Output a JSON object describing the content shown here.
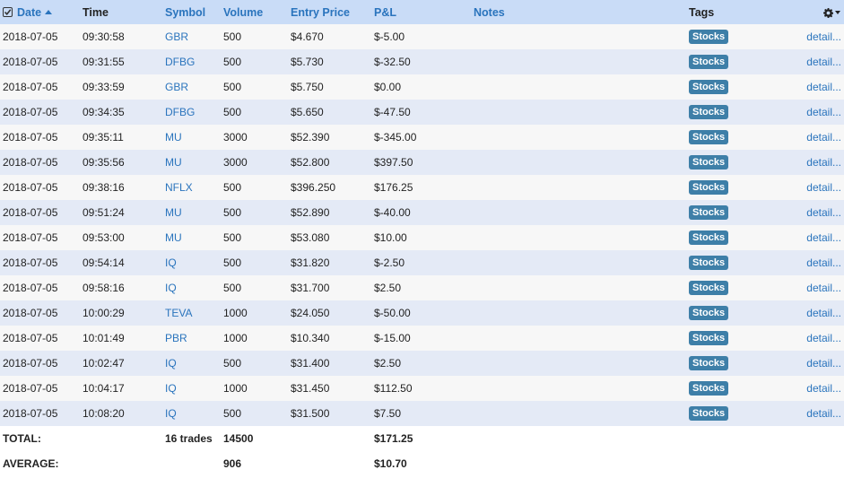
{
  "headers": {
    "date": "Date",
    "time": "Time",
    "symbol": "Symbol",
    "volume": "Volume",
    "entry_price": "Entry Price",
    "pnl": "P&L",
    "notes": "Notes",
    "tags": "Tags"
  },
  "header_icons": {
    "select_all": "checkbox-checked-icon",
    "sort": "sort-ascending-icon",
    "settings": "gear-icon",
    "settings_menu": "caret-down-icon"
  },
  "trades": [
    {
      "date": "2018-07-05",
      "time": "09:30:58",
      "symbol": "GBR",
      "volume": "500",
      "entry_price": "$4.670",
      "pnl": "$-5.00",
      "notes": "",
      "tag": "Stocks",
      "link": "detail..."
    },
    {
      "date": "2018-07-05",
      "time": "09:31:55",
      "symbol": "DFBG",
      "volume": "500",
      "entry_price": "$5.730",
      "pnl": "$-32.50",
      "notes": "",
      "tag": "Stocks",
      "link": "detail..."
    },
    {
      "date": "2018-07-05",
      "time": "09:33:59",
      "symbol": "GBR",
      "volume": "500",
      "entry_price": "$5.750",
      "pnl": "$0.00",
      "notes": "",
      "tag": "Stocks",
      "link": "detail..."
    },
    {
      "date": "2018-07-05",
      "time": "09:34:35",
      "symbol": "DFBG",
      "volume": "500",
      "entry_price": "$5.650",
      "pnl": "$-47.50",
      "notes": "",
      "tag": "Stocks",
      "link": "detail..."
    },
    {
      "date": "2018-07-05",
      "time": "09:35:11",
      "symbol": "MU",
      "volume": "3000",
      "entry_price": "$52.390",
      "pnl": "$-345.00",
      "notes": "",
      "tag": "Stocks",
      "link": "detail..."
    },
    {
      "date": "2018-07-05",
      "time": "09:35:56",
      "symbol": "MU",
      "volume": "3000",
      "entry_price": "$52.800",
      "pnl": "$397.50",
      "notes": "",
      "tag": "Stocks",
      "link": "detail..."
    },
    {
      "date": "2018-07-05",
      "time": "09:38:16",
      "symbol": "NFLX",
      "volume": "500",
      "entry_price": "$396.250",
      "pnl": "$176.25",
      "notes": "",
      "tag": "Stocks",
      "link": "detail..."
    },
    {
      "date": "2018-07-05",
      "time": "09:51:24",
      "symbol": "MU",
      "volume": "500",
      "entry_price": "$52.890",
      "pnl": "$-40.00",
      "notes": "",
      "tag": "Stocks",
      "link": "detail..."
    },
    {
      "date": "2018-07-05",
      "time": "09:53:00",
      "symbol": "MU",
      "volume": "500",
      "entry_price": "$53.080",
      "pnl": "$10.00",
      "notes": "",
      "tag": "Stocks",
      "link": "detail..."
    },
    {
      "date": "2018-07-05",
      "time": "09:54:14",
      "symbol": "IQ",
      "volume": "500",
      "entry_price": "$31.820",
      "pnl": "$-2.50",
      "notes": "",
      "tag": "Stocks",
      "link": "detail..."
    },
    {
      "date": "2018-07-05",
      "time": "09:58:16",
      "symbol": "IQ",
      "volume": "500",
      "entry_price": "$31.700",
      "pnl": "$2.50",
      "notes": "",
      "tag": "Stocks",
      "link": "detail..."
    },
    {
      "date": "2018-07-05",
      "time": "10:00:29",
      "symbol": "TEVA",
      "volume": "1000",
      "entry_price": "$24.050",
      "pnl": "$-50.00",
      "notes": "",
      "tag": "Stocks",
      "link": "detail..."
    },
    {
      "date": "2018-07-05",
      "time": "10:01:49",
      "symbol": "PBR",
      "volume": "1000",
      "entry_price": "$10.340",
      "pnl": "$-15.00",
      "notes": "",
      "tag": "Stocks",
      "link": "detail..."
    },
    {
      "date": "2018-07-05",
      "time": "10:02:47",
      "symbol": "IQ",
      "volume": "500",
      "entry_price": "$31.400",
      "pnl": "$2.50",
      "notes": "",
      "tag": "Stocks",
      "link": "detail..."
    },
    {
      "date": "2018-07-05",
      "time": "10:04:17",
      "symbol": "IQ",
      "volume": "1000",
      "entry_price": "$31.450",
      "pnl": "$112.50",
      "notes": "",
      "tag": "Stocks",
      "link": "detail..."
    },
    {
      "date": "2018-07-05",
      "time": "10:08:20",
      "symbol": "IQ",
      "volume": "500",
      "entry_price": "$31.500",
      "pnl": "$7.50",
      "notes": "",
      "tag": "Stocks",
      "link": "detail..."
    }
  ],
  "totals": {
    "label": "TOTAL:",
    "trades": "16 trades",
    "volume": "14500",
    "pnl": "$171.25"
  },
  "average": {
    "label": "AVERAGE:",
    "volume": "906",
    "pnl": "$10.70"
  },
  "colors": {
    "header_bg": "#c9dcf7",
    "row_odd": "#f7f7f7",
    "row_even": "#e4eaf6",
    "link": "#2a74bd",
    "tag_bg": "#3e7fa8"
  }
}
